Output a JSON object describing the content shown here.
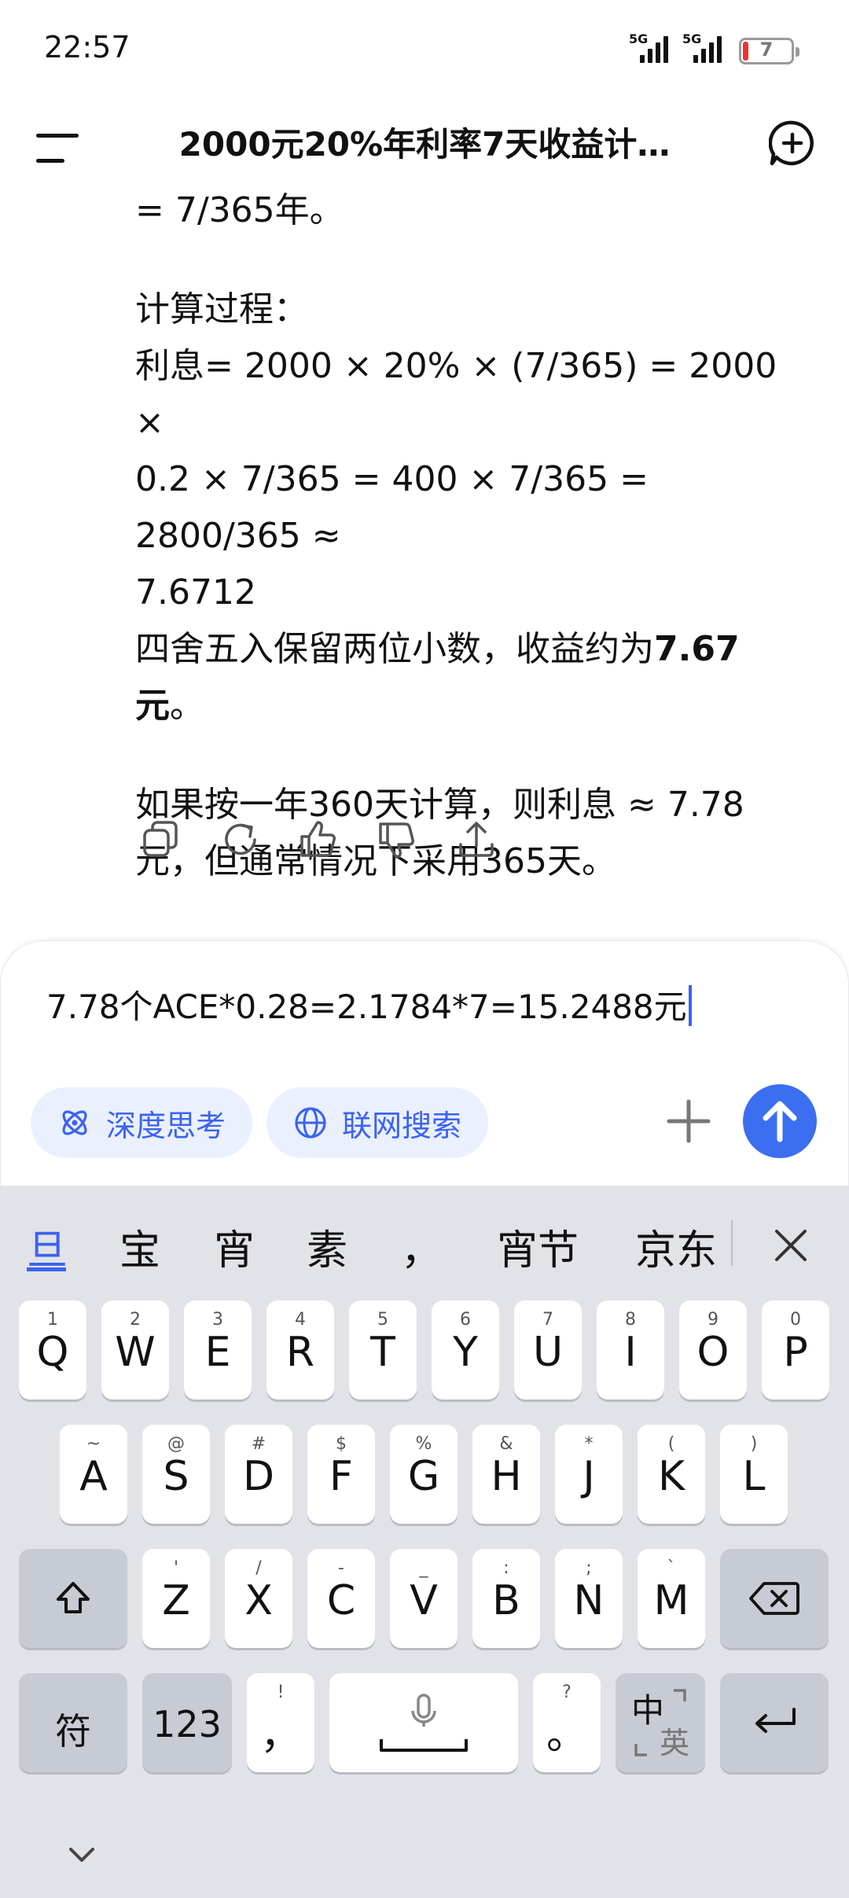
{
  "status_bar": {
    "time": "22:57",
    "signal1_label": "5G",
    "signal2_label": "5G",
    "battery_level": "7",
    "battery_percent": 7
  },
  "header": {
    "title": "2000元20%年利率7天收益计…",
    "menu_icon": "menu-icon",
    "new_chat_icon": "new-chat-icon"
  },
  "message": {
    "line0": "= 7/365年。",
    "calc_heading": "计算过程：",
    "calc_line1": "利息= 2000 × 20% × (7/365) = 2000 ×",
    "calc_line2": "0.2 × 7/365 = 400 × 7/365 = 2800/365 ≈",
    "calc_line3": "7.6712",
    "round_prefix": "四舍五入保留两位小数，收益约为",
    "round_bold1": "7.67",
    "round_bold2": "元",
    "round_suffix": "。",
    "alt_line1": "如果按一年360天计算，则利息 ≈ 7.78",
    "alt_line2": "元，但通常情况下采用365天。"
  },
  "message_actions": [
    "copy-icon",
    "refresh-icon",
    "thumbs-up-icon",
    "thumbs-down-icon",
    "share-icon"
  ],
  "input": {
    "value": "7.78个ACE*0.28=2.1784*7=15.2488元",
    "deep_think_label": "深度思考",
    "web_search_label": "联网搜索",
    "accent_color": "#3b6ef0"
  },
  "keyboard": {
    "candidates": [
      "旦",
      "宝",
      "宵",
      "素",
      "，",
      "宵节",
      "京东"
    ],
    "row1": [
      {
        "sub": "1",
        "main": "Q"
      },
      {
        "sub": "2",
        "main": "W"
      },
      {
        "sub": "3",
        "main": "E"
      },
      {
        "sub": "4",
        "main": "R"
      },
      {
        "sub": "5",
        "main": "T"
      },
      {
        "sub": "6",
        "main": "Y"
      },
      {
        "sub": "7",
        "main": "U"
      },
      {
        "sub": "8",
        "main": "I"
      },
      {
        "sub": "9",
        "main": "O"
      },
      {
        "sub": "0",
        "main": "P"
      }
    ],
    "row2": [
      {
        "sub": "~",
        "main": "A"
      },
      {
        "sub": "@",
        "main": "S"
      },
      {
        "sub": "#",
        "main": "D"
      },
      {
        "sub": "$",
        "main": "F"
      },
      {
        "sub": "%",
        "main": "G"
      },
      {
        "sub": "&",
        "main": "H"
      },
      {
        "sub": "*",
        "main": "J"
      },
      {
        "sub": "(",
        "main": "K"
      },
      {
        "sub": ")",
        "main": "L"
      }
    ],
    "row3": [
      {
        "sub": "'",
        "main": "Z"
      },
      {
        "sub": "/",
        "main": "X"
      },
      {
        "sub": "-",
        "main": "C"
      },
      {
        "sub": "_",
        "main": "V"
      },
      {
        "sub": ":",
        "main": "B"
      },
      {
        "sub": ";",
        "main": "N"
      },
      {
        "sub": "`",
        "main": "M"
      }
    ],
    "symbol_key": "符",
    "num_key": "123",
    "comma_sub": "!",
    "comma_main": "，",
    "period_sub": "?",
    "period_main": "。",
    "lang_key_top": "中",
    "lang_key_bottom": "英"
  }
}
